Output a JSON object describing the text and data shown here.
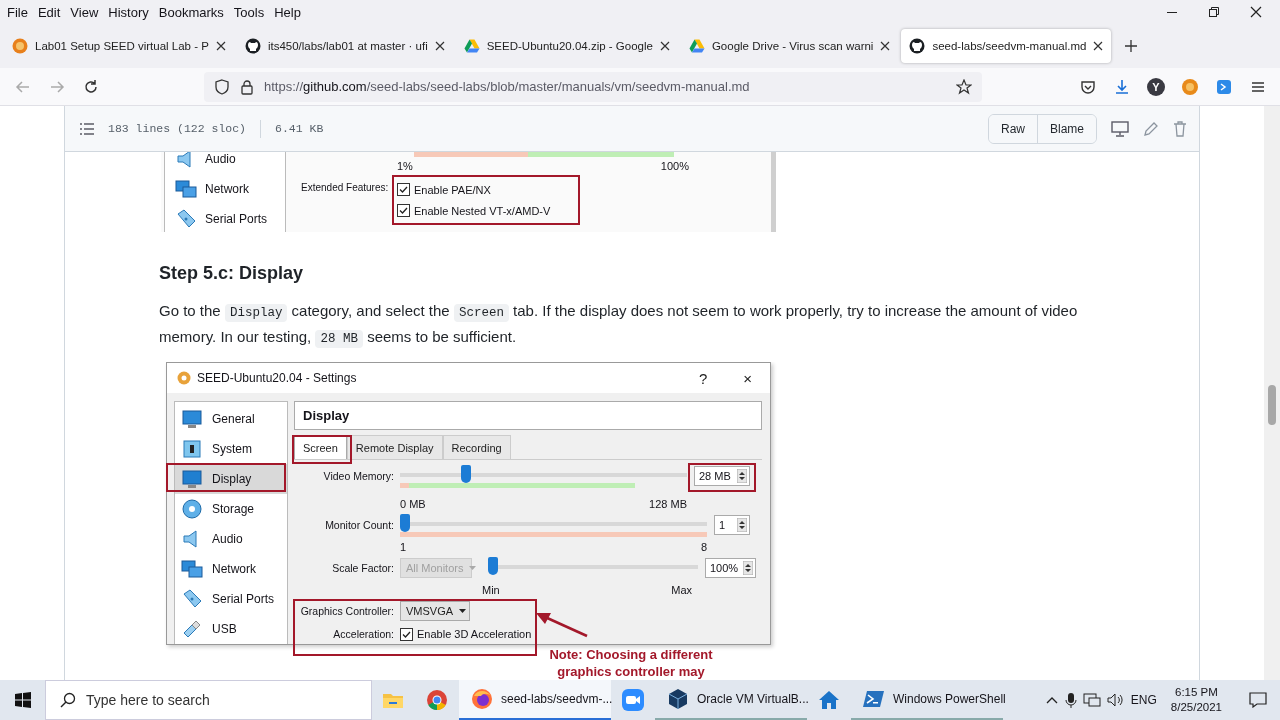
{
  "menu_bar": [
    "File",
    "Edit",
    "View",
    "History",
    "Bookmarks",
    "Tools",
    "Help"
  ],
  "tabs": [
    {
      "kind": "lab",
      "title": "Lab01 Setup SEED virtual Lab - P",
      "selected": false
    },
    {
      "kind": "github",
      "title": "its450/labs/lab01 at master · ufi",
      "selected": false
    },
    {
      "kind": "drive",
      "title": "SEED-Ubuntu20.04.zip - Google",
      "selected": false
    },
    {
      "kind": "drive",
      "title": "Google Drive - Virus scan warni",
      "selected": false
    },
    {
      "kind": "github",
      "title": "seed-labs/seedvm-manual.md",
      "selected": true
    }
  ],
  "address_bar": {
    "scheme": "https://",
    "host": "github.com",
    "path": "/seed-labs/seed-labs/blob/master/manuals/vm/seedvm-manual.md"
  },
  "account_badge": "Y",
  "file_header": {
    "lines": "183 lines (122 sloc)",
    "size": "6.41 KB",
    "buttons": [
      "Raw",
      "Blame"
    ]
  },
  "top_figure": {
    "sidebar": [
      {
        "kind": "audio",
        "label": "Audio"
      },
      {
        "kind": "network",
        "label": "Network"
      },
      {
        "kind": "serial",
        "label": "Serial Ports"
      }
    ],
    "scale_min": "1%",
    "scale_max": "100%",
    "features_label": "Extended Features:",
    "options": [
      {
        "label": "Enable PAE/NX",
        "checked": true
      },
      {
        "label": "Enable Nested VT-x/AMD-V",
        "checked": true
      }
    ]
  },
  "heading": "Step 5.c: Display",
  "paragraph": [
    {
      "kind": "text",
      "text": "Go to the "
    },
    {
      "kind": "code",
      "text": "Display"
    },
    {
      "kind": "text",
      "text": " category, and select the "
    },
    {
      "kind": "code",
      "text": "Screen"
    },
    {
      "kind": "text",
      "text": " tab. If the display does not seem to work properly, try to increase the amount of video memory. In our testing, "
    },
    {
      "kind": "code",
      "text": "28 MB"
    },
    {
      "kind": "text",
      "text": " seems to be sufficient."
    }
  ],
  "settings_window": {
    "title": "SEED-Ubuntu20.04 - Settings",
    "help": "?",
    "close": "×",
    "sidebar": [
      {
        "kind": "general",
        "label": "General",
        "selected": false
      },
      {
        "kind": "system",
        "label": "System",
        "selected": false
      },
      {
        "kind": "display",
        "label": "Display",
        "selected": true
      },
      {
        "kind": "storage",
        "label": "Storage",
        "selected": false
      },
      {
        "kind": "audio",
        "label": "Audio",
        "selected": false
      },
      {
        "kind": "network",
        "label": "Network",
        "selected": false
      },
      {
        "kind": "serial",
        "label": "Serial Ports",
        "selected": false
      },
      {
        "kind": "usb",
        "label": "USB",
        "selected": false
      }
    ],
    "section_title": "Display",
    "tabs": [
      {
        "label": "Screen",
        "selected": true
      },
      {
        "label": "Remote Display",
        "selected": false
      },
      {
        "label": "Recording",
        "selected": false
      }
    ],
    "video_memory": {
      "label": "Video Memory:",
      "level": 0.22,
      "min": "0 MB",
      "max": "128 MB",
      "value": "28 MB"
    },
    "monitor_count": {
      "label": "Monitor Count:",
      "level": 0,
      "min": "1",
      "max": "8",
      "value": "1"
    },
    "scale_factor": {
      "label": "Scale Factor:",
      "combo": "All Monitors",
      "combo_disabled": true,
      "level": 0,
      "min": "Min",
      "max": "Max",
      "value": "100%"
    },
    "graphics_controller": {
      "label": "Graphics Controller:",
      "value": "VMSVGA"
    },
    "acceleration": {
      "label": "Acceleration:",
      "option": "Enable 3D Acceleration",
      "checked": true
    }
  },
  "note": "Note: Choosing a different graphics controller may",
  "taskbar": {
    "search_placeholder": "Type here to search",
    "apps": [
      {
        "kind": "folder",
        "selected": false
      },
      {
        "kind": "chrome",
        "selected": false
      },
      {
        "kind": "firefox",
        "label": "seed-labs/seedvm-...",
        "selected": true
      },
      {
        "kind": "zoom",
        "selected": false
      },
      {
        "kind": "virtualbox",
        "label": "Oracle VM VirtualB...",
        "selected": false
      },
      {
        "kind": "home",
        "selected": false
      },
      {
        "kind": "powershell",
        "label": "Windows PowerShell",
        "selected": false
      }
    ],
    "language": "ENG",
    "time": "6:15 PM",
    "date": "8/25/2021"
  }
}
